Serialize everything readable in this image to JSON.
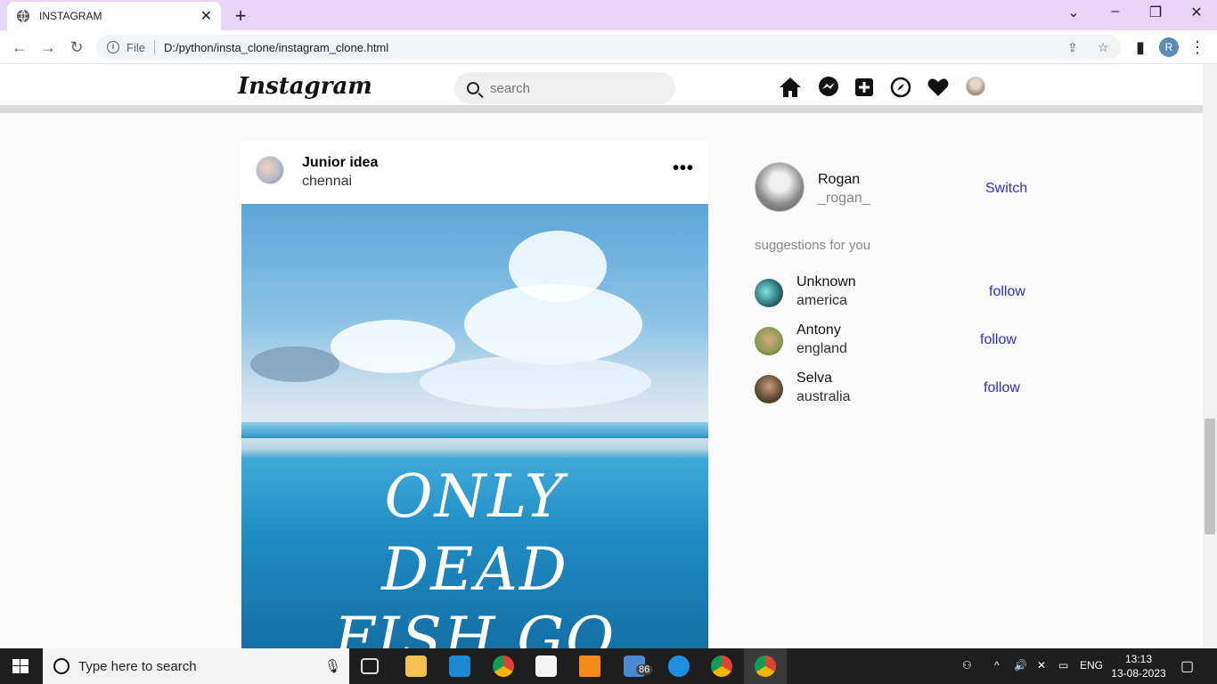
{
  "browser": {
    "tab_title": "INSTAGRAM",
    "url_scheme": "File",
    "url": "D:/python/insta_clone/instagram_clone.html",
    "profile_initial": "R"
  },
  "header": {
    "logo": "Instagram",
    "search_placeholder": "search",
    "nav_icons": [
      "home-icon",
      "messenger-icon",
      "add-post-icon",
      "explore-icon",
      "heart-icon",
      "profile-avatar"
    ]
  },
  "post": {
    "username": "Junior idea",
    "location": "chennai",
    "more_label": "•••",
    "image_text": [
      "ONLY",
      "DEAD",
      "FISH GO"
    ]
  },
  "sidebar": {
    "me": {
      "name": "Rogan",
      "handle": "_rogan_",
      "switch_label": "Switch"
    },
    "suggestions_title": "suggestions for you",
    "suggestions": [
      {
        "name": "Unknown",
        "location": "america",
        "action": "follow"
      },
      {
        "name": "Antony",
        "location": "england",
        "action": "follow"
      },
      {
        "name": "Selva",
        "location": "australia",
        "action": "follow"
      }
    ]
  },
  "taskbar": {
    "search_placeholder": "Type here to search",
    "mail_badge": "86",
    "language": "ENG",
    "time": "13:13",
    "date": "13-08-2023"
  },
  "colors": {
    "link": "#2d2fd6",
    "tabbar": "#e7d5f7"
  }
}
